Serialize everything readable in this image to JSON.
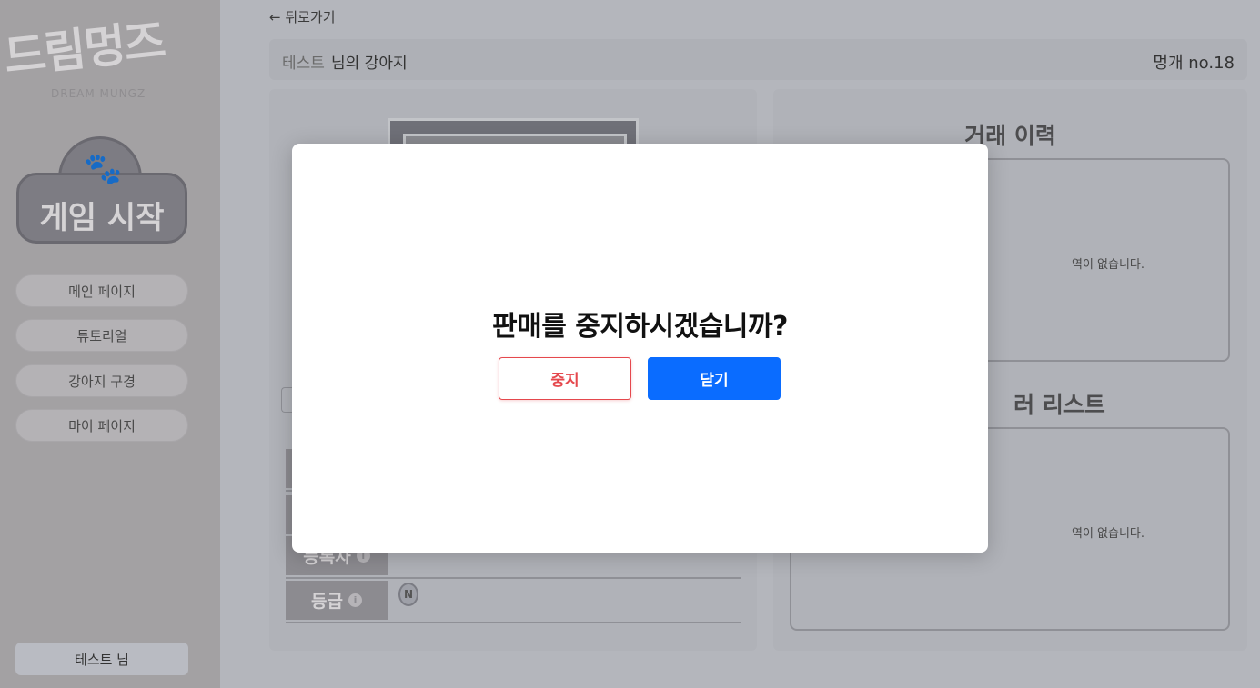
{
  "sidebar": {
    "logo_text": "드림멍즈",
    "logo_sub": "DREAM MUNGZ",
    "game_start_label": "게임 시작",
    "nav": [
      {
        "label": "메인 페이지"
      },
      {
        "label": "튜토리얼"
      },
      {
        "label": "강아지 구경"
      },
      {
        "label": "마이 페이지"
      }
    ],
    "user_label": "테스트 님"
  },
  "header": {
    "back_label": "← 뒤로가기",
    "owner": "테스트",
    "owner_suffix": "님의 강아지",
    "dog_no": "멍개 no.18"
  },
  "detail": {
    "rows": [
      {
        "label": "등록자"
      },
      {
        "label": "등급"
      }
    ],
    "grade_value": "N"
  },
  "right_panel": {
    "history_title": "거래 이력",
    "history_empty": "역이 없습니다.",
    "offer_title": "러 리스트",
    "offer_empty": "역이 없습니다."
  },
  "modal": {
    "title": "판매를 중지하시겠습니까?",
    "stop_label": "중지",
    "close_label": "닫기"
  },
  "colors": {
    "primary": "#0a6cff",
    "danger": "#e5484d"
  }
}
